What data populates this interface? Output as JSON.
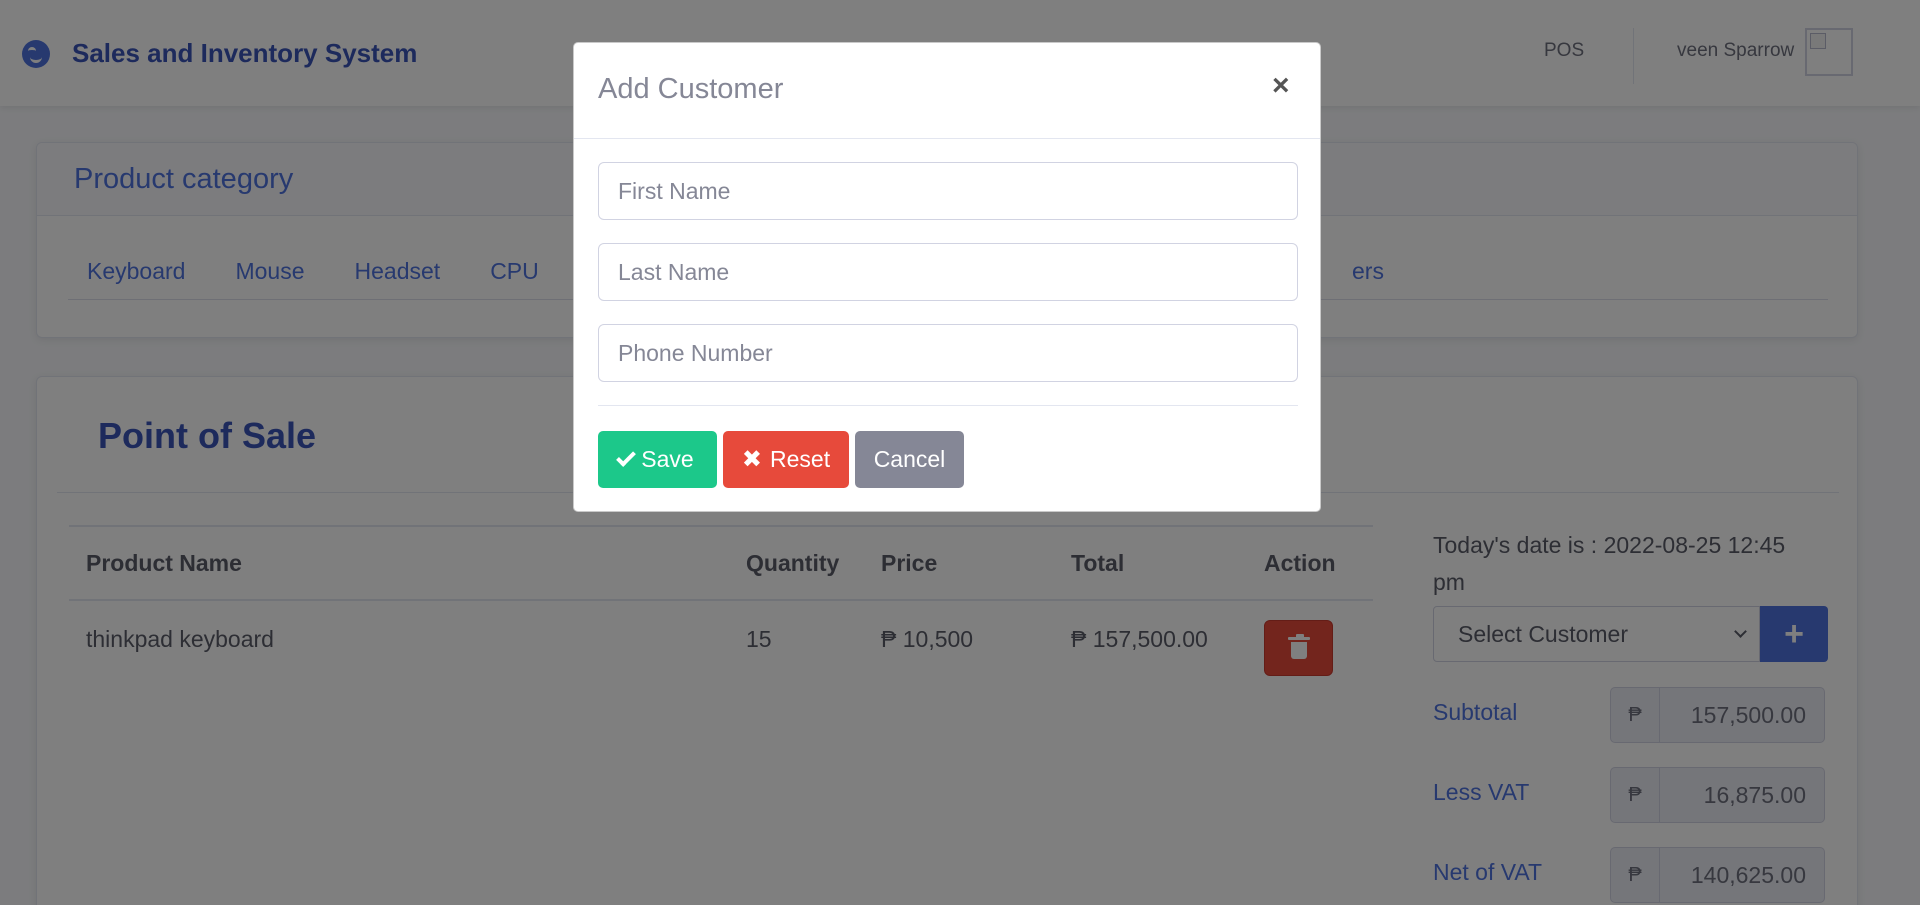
{
  "navbar": {
    "brand": "Sales and Inventory System",
    "brand_icon": "laugh-icon",
    "nav_link": "POS",
    "user_name": "veen Sparrow"
  },
  "category": {
    "title": "Product category",
    "tabs": [
      "Keyboard",
      "Mouse",
      "Headset",
      "CPU"
    ],
    "tab_partial": "ers"
  },
  "pos": {
    "title": "Point of Sale",
    "columns": [
      "Product Name",
      "Quantity",
      "Price",
      "Total",
      "Action"
    ],
    "rows": [
      {
        "name": "thinkpad keyboard",
        "quantity": "15",
        "price": "₱ 10,500",
        "total": "₱ 157,500.00"
      }
    ]
  },
  "side": {
    "date_text": "Today's date is : 2022-08-25 12:45 pm",
    "customer_select": "Select Customer",
    "add_button": "+",
    "currency": "₱",
    "subtotal_label": "Subtotal",
    "subtotal_value": "157,500.00",
    "vat_label": "Less VAT",
    "vat_value": "16,875.00",
    "net_label": "Net of VAT",
    "net_value": "140,625.00"
  },
  "modal": {
    "title": "Add Customer",
    "close": "×",
    "first_name_placeholder": "First Name",
    "last_name_placeholder": "Last Name",
    "phone_placeholder": "Phone Number",
    "save_label": "Save",
    "reset_label": "Reset",
    "cancel_label": "Cancel",
    "reset_icon": "✖"
  },
  "colors": {
    "primary": "#4e73df",
    "success": "#1cc88a",
    "danger": "#e74a3b",
    "secondary": "#858796"
  }
}
